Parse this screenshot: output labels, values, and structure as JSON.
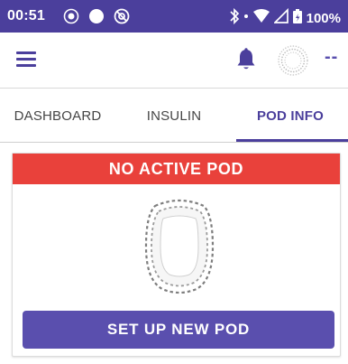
{
  "status_bar": {
    "time": "00:51",
    "battery": "100%",
    "icons": [
      "focus-icon",
      "record-icon",
      "do-not-disturb-icon",
      "bluetooth-icon",
      "data-icon",
      "wifi-icon",
      "signal-icon",
      "battery-icon"
    ]
  },
  "app_bar": {
    "icons": [
      "menu-icon",
      "bell-icon",
      "status-ring-icon"
    ],
    "status_value": "--"
  },
  "tabs": [
    {
      "label": "DASHBOARD",
      "active": false
    },
    {
      "label": "INSULIN",
      "active": false
    },
    {
      "label": "POD INFO",
      "active": true
    }
  ],
  "pod_card": {
    "banner": "NO ACTIVE POD",
    "graphic": "pod-outline-graphic",
    "button": "SET UP NEW POD"
  },
  "colors": {
    "primary": "#4b3f9c",
    "button": "#5a4fae",
    "alert": "#e9413b",
    "status_bar": "#4b3f9c"
  }
}
